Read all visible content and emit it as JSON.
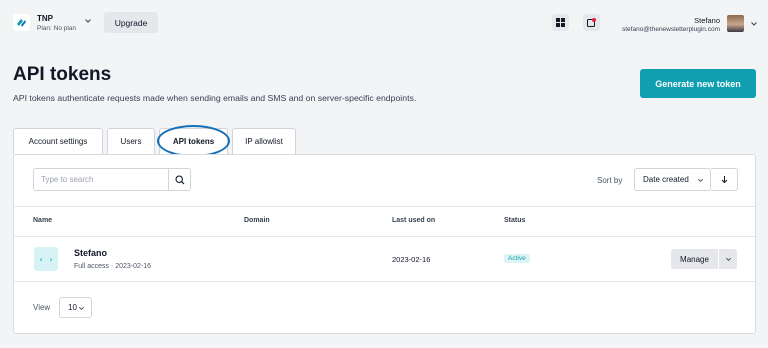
{
  "topbar": {
    "org_name": "TNP",
    "org_plan": "Plan: No plan",
    "upgrade_label": "Upgrade",
    "user_name": "Stefano",
    "user_email": "stefano@thenewsletterplugin.com"
  },
  "header": {
    "title": "API tokens",
    "description": "API tokens authenticate requests made when sending emails and SMS and on server-specific endpoints.",
    "generate_label": "Generate new token"
  },
  "tabs": [
    {
      "label": "Account settings",
      "active": false
    },
    {
      "label": "Users",
      "active": false
    },
    {
      "label": "API tokens",
      "active": true
    },
    {
      "label": "IP allowlist",
      "active": false
    }
  ],
  "toolbar": {
    "search_placeholder": "Type to search",
    "sort_label": "Sort by",
    "sort_value": "Date created"
  },
  "table": {
    "columns": [
      "Name",
      "Domain",
      "Last used on",
      "Status"
    ],
    "rows": [
      {
        "name": "Stefano",
        "access": "Full access",
        "created": "2023-02-16",
        "domain": "",
        "last_used": "2023-02-16",
        "status": "Active",
        "manage_label": "Manage"
      }
    ]
  },
  "footer": {
    "view_label": "View",
    "view_value": "10"
  },
  "colors": {
    "accent": "#0f9fb0",
    "highlight_ring": "#1670b7",
    "status_active_bg": "#ddf4f5"
  },
  "icons": [
    "logo-icon",
    "chevron-down-icon",
    "grid-icon",
    "notification-icon",
    "search-icon",
    "arrow-down-icon",
    "code-brackets-icon"
  ]
}
